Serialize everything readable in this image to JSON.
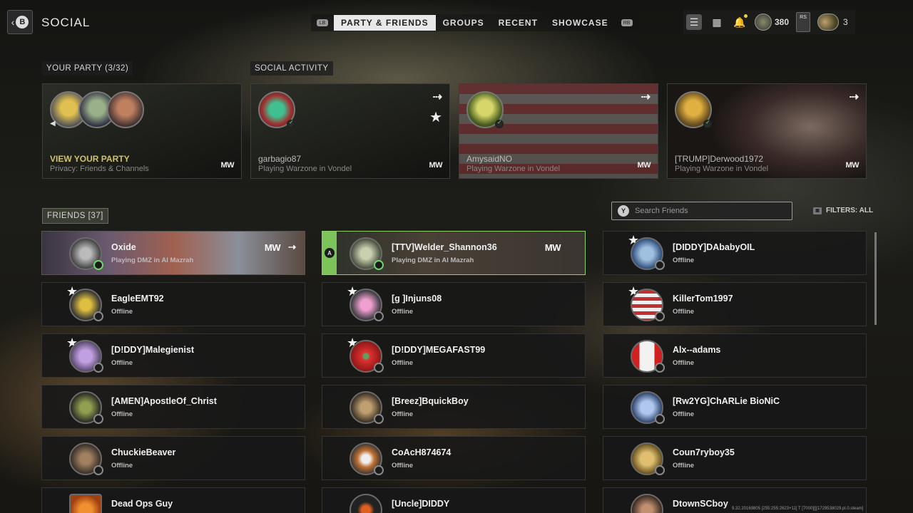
{
  "header": {
    "back_label": "B",
    "title": "SOCIAL",
    "tabs": [
      "PARTY & FRIENDS",
      "GROUPS",
      "RECENT",
      "SHOWCASE"
    ],
    "lb": "LB",
    "rb": "RB",
    "cod_points": "380",
    "rs": "RS",
    "party_count": "3"
  },
  "party": {
    "label": "YOUR PARTY (3/32)",
    "title": "VIEW YOUR PARTY",
    "privacy": "Privacy: Friends & Channels"
  },
  "activity": {
    "label": "SOCIAL ACTIVITY",
    "cards": [
      {
        "name": "garbagio87",
        "status": "Playing Warzone in Vondel"
      },
      {
        "name": "AmysaidNO",
        "status": "Playing Warzone in Vondel"
      },
      {
        "name": "[TRUMP]Derwood1972",
        "status": "Playing Warzone in Vondel"
      }
    ],
    "game_logo": "MW"
  },
  "friends": {
    "label": "FRIENDS [37]",
    "search_placeholder": "Search Friends",
    "search_button": "Y",
    "filters": "FILTERS: ALL",
    "selected_button": "A",
    "items": [
      {
        "name": "Oxide",
        "status": "Playing DMZ in Al Mazrah"
      },
      {
        "name": "[TTV]Welder_Shannon36",
        "status": "Playing DMZ in Al Mazrah"
      },
      {
        "name": "[DIDDY]DAbabyOIL",
        "status": "Offline"
      },
      {
        "name": "EagleEMT92",
        "status": "Offline"
      },
      {
        "name": "[g   ]Injuns08",
        "status": "Offline"
      },
      {
        "name": "KillerTom1997",
        "status": "Offline"
      },
      {
        "name": "[D!DDY]Malegienist",
        "status": "Offline"
      },
      {
        "name": "[D!DDY]MEGAFAST99",
        "status": "Offline"
      },
      {
        "name": "Alx--adams",
        "status": "Offline"
      },
      {
        "name": "[AMEN]ApostleOf_Christ",
        "status": "Offline"
      },
      {
        "name": "[Breez]BquickBoy",
        "status": "Offline"
      },
      {
        "name": "[Rw2YG]ChARLie BioNiC",
        "status": "Offline"
      },
      {
        "name": "ChuckieBeaver",
        "status": "Offline"
      },
      {
        "name": "CoAcH874674",
        "status": "Offline"
      },
      {
        "name": "Coun7ryboy35",
        "status": "Offline"
      },
      {
        "name": "Dead Ops Guy",
        "status": ""
      },
      {
        "name": "[Uncle]DIDDY",
        "status": ""
      },
      {
        "name": "DtownSCboy",
        "status": ""
      }
    ]
  },
  "version": "9.32.20169805 [255:255:2623+11] T [7000][][1729538029.pl.0.steam]"
}
